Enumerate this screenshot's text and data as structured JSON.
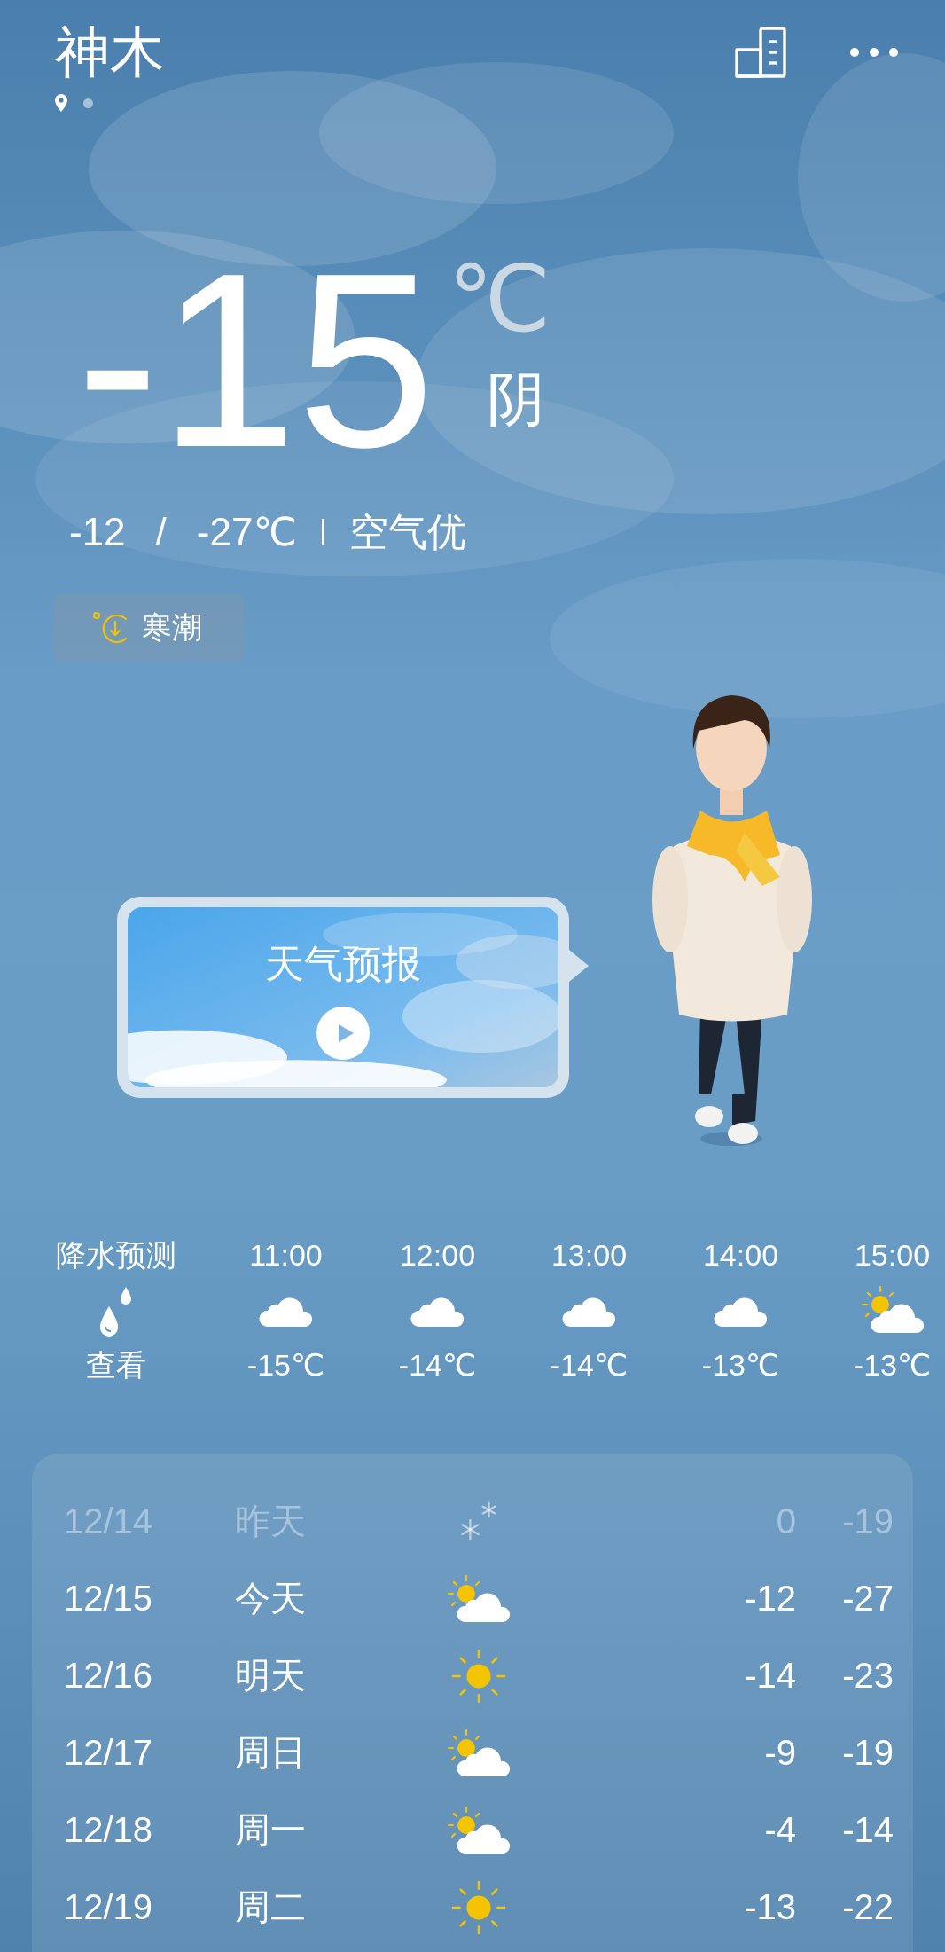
{
  "city": "神木",
  "current": {
    "temp": "-15",
    "unit": "℃",
    "condition": "阴",
    "high": "-12",
    "separator": "/",
    "low": "-27℃",
    "air_quality": "空气优"
  },
  "alert": {
    "label": "寒潮"
  },
  "video": {
    "title": "天气预报"
  },
  "hourly": [
    {
      "kind": "precip",
      "label": "降水预测",
      "action": "查看"
    },
    {
      "kind": "cloudy",
      "time": "11:00",
      "temp": "-15℃"
    },
    {
      "kind": "cloudy",
      "time": "12:00",
      "temp": "-14℃"
    },
    {
      "kind": "cloudy",
      "time": "13:00",
      "temp": "-14℃"
    },
    {
      "kind": "cloudy",
      "time": "14:00",
      "temp": "-13℃"
    },
    {
      "kind": "partly_cloudy",
      "time": "15:00",
      "temp": "-13℃"
    }
  ],
  "daily": [
    {
      "date": "12/14",
      "day": "昨天",
      "kind": "snow",
      "high": "0",
      "low": "-19",
      "past": true
    },
    {
      "date": "12/15",
      "day": "今天",
      "kind": "partly_cloudy",
      "high": "-12",
      "low": "-27",
      "past": false
    },
    {
      "date": "12/16",
      "day": "明天",
      "kind": "sunny",
      "high": "-14",
      "low": "-23",
      "past": false
    },
    {
      "date": "12/17",
      "day": "周日",
      "kind": "partly_cloudy",
      "high": "-9",
      "low": "-19",
      "past": false
    },
    {
      "date": "12/18",
      "day": "周一",
      "kind": "partly_cloudy",
      "high": "-4",
      "low": "-14",
      "past": false
    },
    {
      "date": "12/19",
      "day": "周二",
      "kind": "sunny",
      "high": "-13",
      "low": "-22",
      "past": false
    }
  ]
}
